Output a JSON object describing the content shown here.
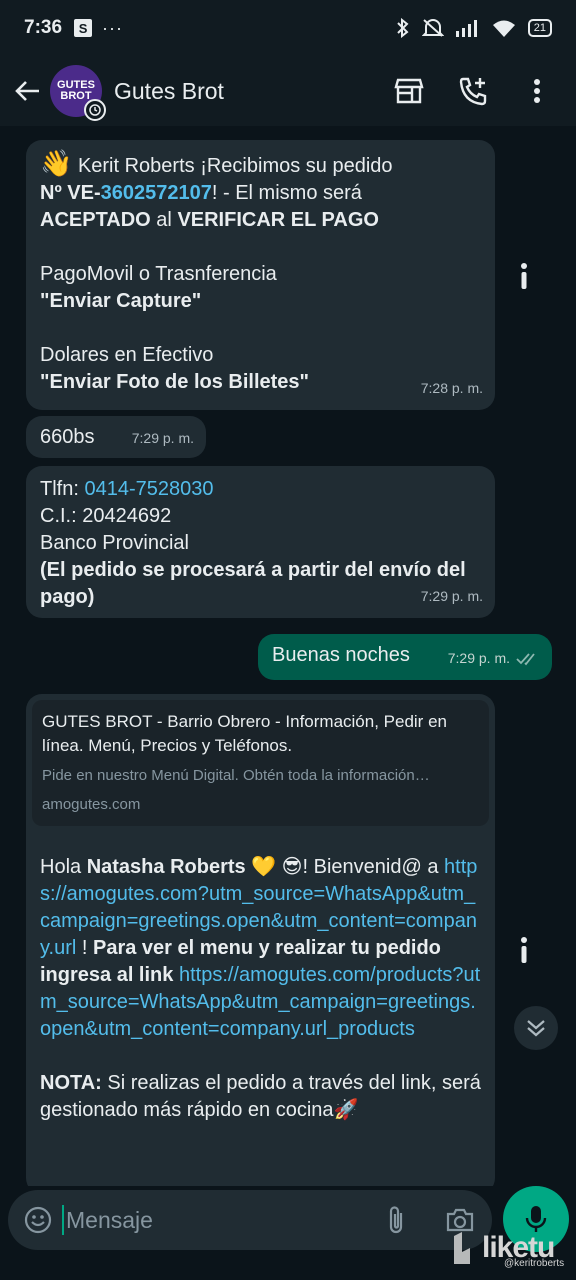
{
  "status_bar": {
    "time": "7:36",
    "s_badge": "S",
    "dots": "···",
    "battery": "21"
  },
  "header": {
    "avatar_line1": "GUTES",
    "avatar_line2": "BROT",
    "title": "Gutes Brot",
    "icons": [
      "back-arrow-icon",
      "store-icon",
      "add-call-icon",
      "more-vert-icon"
    ]
  },
  "messages": {
    "m1": {
      "emoji": "👋",
      "greeting": "Kerit Roberts ¡Recibimos su pedido",
      "order_prefix": "Nº VE-",
      "order_number": "3602572107",
      "order_suffix": "! - El mismo será",
      "accepted": "ACEPTADO",
      "al": " al ",
      "verify": "VERIFICAR EL PAGO",
      "method1": "PagoMovil o Trasnferencia",
      "method1_action": "\"Enviar Capture\"",
      "method2": "Dolares en Efectivo",
      "method2_action": "\"Enviar Foto de los Billetes\"",
      "time": "7:28 p. m."
    },
    "m2": {
      "text": "660bs",
      "time": "7:29 p. m."
    },
    "m3": {
      "tlfn_label": "Tlfn: ",
      "tlfn": "0414-7528030",
      "ci": "C.I.: 20424692",
      "bank": "Banco Provincial",
      "note": "(El pedido se procesará a partir del envío del pago)",
      "time": "7:29 p. m."
    },
    "m4": {
      "text": "Buenas noches",
      "time": "7:29 p. m."
    },
    "m5": {
      "preview_title": "GUTES BROT - Barrio Obrero - Información, Pedir en línea. Menú, Precios y Teléfonos.",
      "preview_desc": "Pide en nuestro Menú Digital. Obtén toda la información…",
      "preview_domain": "amogutes.com",
      "hola": "Hola ",
      "name": "Natasha Roberts",
      "emojis": " 💛 😎",
      "welcome": "! Bienvenid@",
      "a": "a ",
      "link1": "https://amogutes.com?utm_source=WhatsApp&utm_campaign=greetings.open&utm_content=company.url",
      "excl": " ! ",
      "cta": "Para ver el menu y realizar tu pedido ingresa al link",
      "link2": "https://amogutes.com/products?utm_source=WhatsApp&utm_campaign=greetings.open&utm_content=company.url_products",
      "nota_label": "NOTA:",
      "nota_text": " Si realizas el pedido a través del link, será gestionado más rápido en cocina🚀"
    }
  },
  "composer": {
    "placeholder": "Mensaje"
  },
  "watermark": {
    "logo": "liketu",
    "user": "@keritroberts"
  },
  "colors": {
    "background": "#0b141a",
    "incoming_bubble": "#202c33",
    "outgoing_bubble": "#005c4b",
    "accent": "#00a884",
    "link": "#53bdeb"
  }
}
